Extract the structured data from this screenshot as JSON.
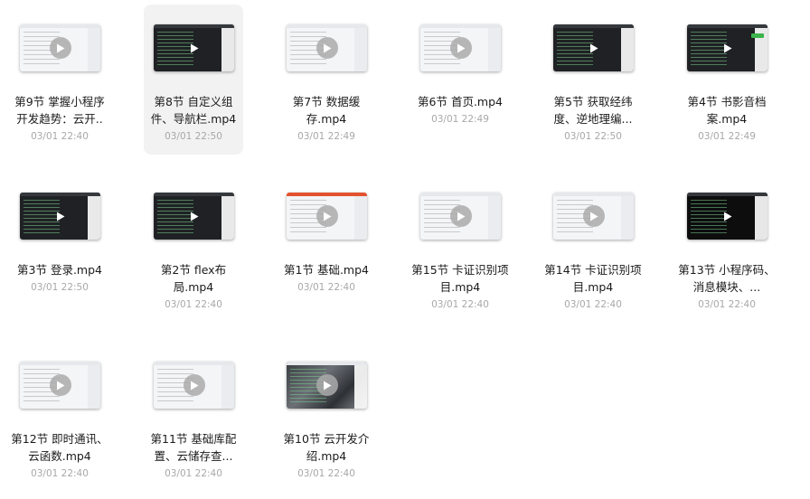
{
  "files": [
    {
      "name": "第9节 掌握小程序开发趋势：云开..",
      "date": "03/01 22:40",
      "thumb": "light",
      "selected": false
    },
    {
      "name": "第8节 自定义组件、导航栏.mp4",
      "date": "03/01 22:50",
      "thumb": "dark",
      "selected": true
    },
    {
      "name": "第7节 数据缓存.mp4",
      "date": "03/01 22:49",
      "thumb": "light",
      "selected": false
    },
    {
      "name": "第6节 首页.mp4",
      "date": "03/01 22:49",
      "thumb": "light",
      "selected": false
    },
    {
      "name": "第5节 获取经纬度、逆地理编...",
      "date": "03/01 22:50",
      "thumb": "dark",
      "selected": false
    },
    {
      "name": "第4节 书影音档案.mp4",
      "date": "03/01 22:49",
      "thumb": "dark",
      "selected": false
    },
    {
      "name": "第3节 登录.mp4",
      "date": "03/01 22:50",
      "thumb": "dark",
      "selected": false
    },
    {
      "name": "第2节 flex布局.mp4",
      "date": "03/01 22:40",
      "thumb": "dark",
      "selected": false
    },
    {
      "name": "第1节 基础.mp4",
      "date": "03/01 22:40",
      "thumb": "light",
      "selected": false
    },
    {
      "name": "第15节 卡证识别项目.mp4",
      "date": "03/01 22:40",
      "thumb": "light",
      "selected": false
    },
    {
      "name": "第14节 卡证识别项目.mp4",
      "date": "03/01 22:40",
      "thumb": "light",
      "selected": false
    },
    {
      "name": "第13节 小程序码、消息模块、...",
      "date": "03/01 22:40",
      "thumb": "black",
      "selected": false
    },
    {
      "name": "第12节 即时通讯、云函数.mp4",
      "date": "03/01 22:40",
      "thumb": "light",
      "selected": false
    },
    {
      "name": "第11节 基础库配置、云储存查...",
      "date": "03/01 22:40",
      "thumb": "light",
      "selected": false
    },
    {
      "name": "第10节 云开发介绍.mp4",
      "date": "03/01 22:40",
      "thumb": "photo",
      "selected": false
    }
  ],
  "colors": {
    "selected_bg": "#f2f2f2",
    "name_text": "#1b1b1b",
    "date_text": "#a8a8a8"
  },
  "icons": {
    "play": "play-icon"
  }
}
